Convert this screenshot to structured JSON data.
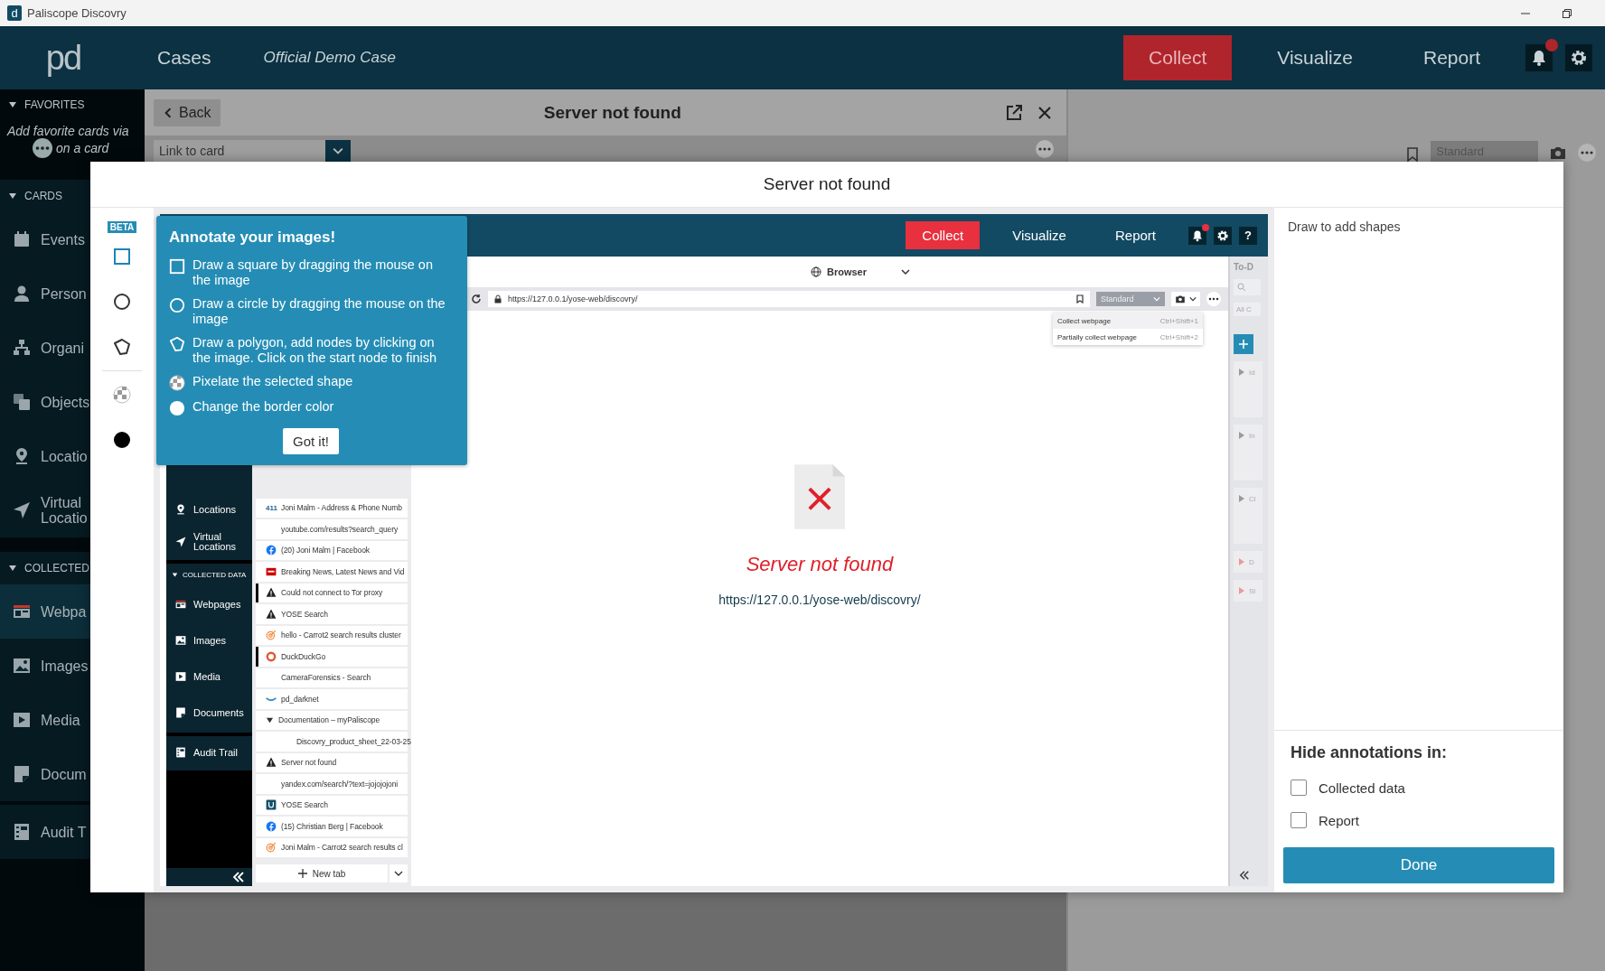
{
  "window": {
    "icon_letter": "d",
    "title": "Paliscope Discovry"
  },
  "header": {
    "logo": "pd",
    "cases": "Cases",
    "case_name": "Official Demo Case",
    "unread_notifications": true,
    "actions": [
      {
        "label": "Collect",
        "selected": true
      },
      {
        "label": "Visualize",
        "selected": false
      },
      {
        "label": "Report",
        "selected": false
      }
    ]
  },
  "sidebar": {
    "favorites": {
      "title": "FAVORITES",
      "expanded": true,
      "hint": "Add favorite cards via",
      "hint_end": "on a card"
    },
    "sections": [
      {
        "title": "CARDS",
        "expanded": true,
        "items": [
          {
            "kind": "calendar",
            "label": "Events",
            "selected": false
          },
          {
            "kind": "person",
            "label": "Person",
            "selected": false
          },
          {
            "kind": "org",
            "label": "Organi",
            "selected": false
          },
          {
            "kind": "objects",
            "label": "Objects",
            "selected": false
          },
          {
            "kind": "pin",
            "label": "Locatio",
            "selected": false
          },
          {
            "kind": "arrow",
            "label": "Virtual Locatio",
            "selected": false
          }
        ]
      },
      {
        "title": "COLLECTED",
        "expanded": true,
        "items": [
          {
            "kind": "webpage",
            "label": "Webpa",
            "selected": true
          },
          {
            "kind": "image",
            "label": "Images",
            "selected": false
          },
          {
            "kind": "media",
            "label": "Media",
            "selected": false
          },
          {
            "kind": "document",
            "label": "Docum",
            "selected": false
          }
        ]
      }
    ],
    "footer": {
      "kind": "audit",
      "label": "Audit T"
    }
  },
  "card": {
    "back": "Back",
    "title": "Server not found",
    "link_placeholder": "Link to card",
    "mode": "Standard"
  },
  "modal": {
    "title": "Server not found",
    "badge": "BETA",
    "tools": [
      {
        "kind": "square",
        "selected": true
      },
      {
        "kind": "circle",
        "selected": false
      },
      {
        "kind": "polygon",
        "selected": false
      },
      {
        "kind": "pixelate"
      },
      {
        "kind": "color",
        "color": "#000000"
      }
    ],
    "hint": "Draw to add shapes",
    "hide_title": "Hide annotations in:",
    "hide_options": [
      {
        "label": "Collected data",
        "checked": false
      },
      {
        "label": "Report",
        "checked": false
      }
    ],
    "done": "Done"
  },
  "tooltip": {
    "title": "Annotate your images!",
    "button": "Got it!",
    "items": [
      {
        "kind": "square",
        "text": "Draw a square by dragging the mouse on the image"
      },
      {
        "kind": "circle",
        "text": "Draw a circle by dragging the mouse on the image"
      },
      {
        "kind": "polygon",
        "text": "Draw a polygon, add nodes by clicking on the image. Click on the start node to finish"
      },
      {
        "kind": "pixelate",
        "text": "Pixelate the selected shape"
      },
      {
        "kind": "color",
        "text": "Change the border color"
      }
    ]
  },
  "screenshot": {
    "header": {
      "unread_notifications": true,
      "help": "?",
      "actions": [
        {
          "label": "Collect",
          "selected": true
        },
        {
          "label": "Visualize",
          "selected": false
        },
        {
          "label": "Report",
          "selected": false
        }
      ]
    },
    "nav": {
      "items": [
        {
          "kind": "pin",
          "label": "Locations"
        },
        {
          "kind": "arrow",
          "label": "Virtual Locations"
        }
      ],
      "section": "COLLECTED DATA",
      "section_expanded": true,
      "section_items": [
        {
          "kind": "webpage",
          "label": "Webpages"
        },
        {
          "kind": "image",
          "label": "Images"
        },
        {
          "kind": "media",
          "label": "Media"
        },
        {
          "kind": "document",
          "label": "Documents"
        }
      ],
      "footer": {
        "kind": "audit",
        "label": "Audit Trail"
      }
    },
    "tabs": [
      {
        "kind": "text-logo",
        "logo": "411",
        "label": "Joni Malm - Address & Phone Numb",
        "marked": false
      },
      {
        "kind": "none",
        "label": "youtube.com/results?search_query",
        "marked": false
      },
      {
        "kind": "facebook",
        "label": "(20) Joni Malm | Facebook",
        "marked": false
      },
      {
        "kind": "news",
        "label": "Breaking News, Latest News and Vid",
        "marked": false
      },
      {
        "kind": "warning",
        "label": "Could not connect to Tor proxy",
        "marked": true
      },
      {
        "kind": "warning",
        "label": "YOSE Search",
        "marked": false
      },
      {
        "kind": "target",
        "label": "hello - Carrot2 search results cluster",
        "marked": false
      },
      {
        "kind": "duck",
        "label": "DuckDuckGo",
        "marked": true
      },
      {
        "kind": "none",
        "label": "CameraForensics - Search",
        "marked": false
      },
      {
        "kind": "wave",
        "label": "pd_darknet",
        "marked": false
      },
      {
        "kind": "group",
        "label": "Documentation – myPaliscope",
        "marked": false,
        "expanded": true,
        "children": [
          {
            "kind": "none",
            "label": "Discovry_product_sheet_22-03-25",
            "marked": false
          }
        ]
      },
      {
        "kind": "warning",
        "label": "Server not found",
        "marked": false
      },
      {
        "kind": "none",
        "label": "yandex.com/search/?text=jojojojoni",
        "marked": false
      },
      {
        "kind": "yose",
        "label": "YOSE Search",
        "marked": false
      },
      {
        "kind": "facebook",
        "label": "(15) Christian Berg | Facebook",
        "marked": false
      },
      {
        "kind": "target",
        "label": "Joni Malm - Carrot2 search results cl",
        "marked": false
      }
    ],
    "new_tab": "New tab",
    "browser": {
      "mode_label": "Browser",
      "url": "https://127.0.0.1/yose-web/discovry/",
      "profile": "Standard",
      "menu": [
        {
          "label": "Collect webpage",
          "shortcut": "Ctrl+Shift+1",
          "selected": true
        },
        {
          "label": "Partially collect webpage",
          "shortcut": "Ctrl+Shift+2",
          "selected": false
        }
      ],
      "error_title": "Server not found",
      "error_url": "https://127.0.0.1/yose-web/discovry/"
    },
    "todo": {
      "title": "To-D",
      "filter": "All C",
      "groups": [
        {
          "label": "Id",
          "color": "#9a9a9a"
        },
        {
          "label": "In",
          "color": "#9a9a9a"
        },
        {
          "label": "Cl",
          "color": "#9a9a9a"
        },
        {
          "label": "D",
          "color": "#e89a9a"
        },
        {
          "label": "Sl",
          "color": "#e89a9a"
        }
      ]
    }
  }
}
